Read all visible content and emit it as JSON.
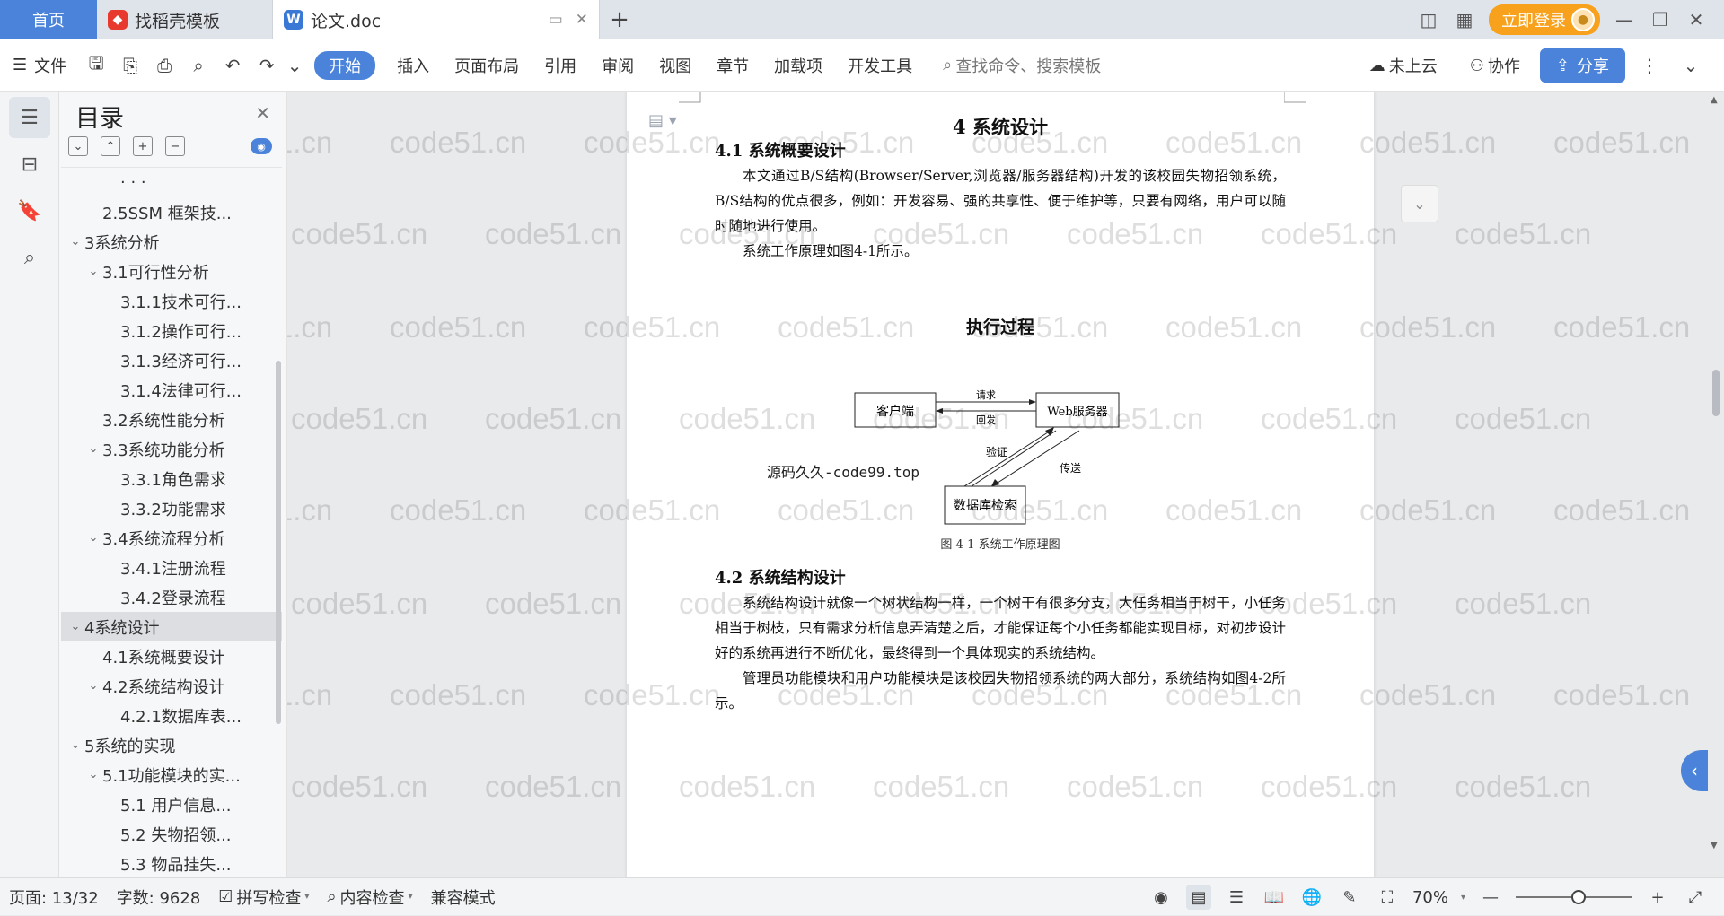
{
  "tabs": {
    "home": "首页",
    "template": "找稻壳模板",
    "doc": "论文.doc"
  },
  "topbar": {
    "login": "立即登录"
  },
  "toolbar": {
    "file": "文件",
    "start": "开始",
    "insert": "插入",
    "layout": "页面布局",
    "reference": "引用",
    "review": "审阅",
    "view": "视图",
    "chapter": "章节",
    "addons": "加载项",
    "devtools": "开发工具",
    "search_placeholder": "查找命令、搜索模板",
    "cloud": "未上云",
    "collab": "协作",
    "share": "分享"
  },
  "nav": {
    "title": "目录",
    "items": [
      {
        "label": "· · ·",
        "level": 3,
        "chev": ""
      },
      {
        "label": "2.5SSM 框架技...",
        "level": 2,
        "chev": ""
      },
      {
        "label": "3系统分析",
        "level": 1,
        "chev": "v"
      },
      {
        "label": "3.1可行性分析",
        "level": 2,
        "chev": "v"
      },
      {
        "label": "3.1.1技术可行...",
        "level": 3,
        "chev": ""
      },
      {
        "label": "3.1.2操作可行...",
        "level": 3,
        "chev": ""
      },
      {
        "label": "3.1.3经济可行...",
        "level": 3,
        "chev": ""
      },
      {
        "label": "3.1.4法律可行...",
        "level": 3,
        "chev": ""
      },
      {
        "label": "3.2系统性能分析",
        "level": 2,
        "chev": ""
      },
      {
        "label": "3.3系统功能分析",
        "level": 2,
        "chev": "v"
      },
      {
        "label": "3.3.1角色需求",
        "level": 3,
        "chev": ""
      },
      {
        "label": "3.3.2功能需求",
        "level": 3,
        "chev": ""
      },
      {
        "label": "3.4系统流程分析",
        "level": 2,
        "chev": "v"
      },
      {
        "label": "3.4.1注册流程",
        "level": 3,
        "chev": ""
      },
      {
        "label": "3.4.2登录流程",
        "level": 3,
        "chev": ""
      },
      {
        "label": "4系统设计",
        "level": 1,
        "chev": "v",
        "selected": true
      },
      {
        "label": "4.1系统概要设计",
        "level": 2,
        "chev": ""
      },
      {
        "label": "4.2系统结构设计",
        "level": 2,
        "chev": "v"
      },
      {
        "label": "4.2.1数据库表...",
        "level": 3,
        "chev": ""
      },
      {
        "label": "5系统的实现",
        "level": 1,
        "chev": "v"
      },
      {
        "label": "5.1功能模块的实...",
        "level": 2,
        "chev": "v"
      },
      {
        "label": "5.1 用户信息...",
        "level": 3,
        "chev": ""
      },
      {
        "label": "5.2  失物招领...",
        "level": 3,
        "chev": ""
      },
      {
        "label": "5.3 物品挂失...",
        "level": 3,
        "chev": ""
      }
    ]
  },
  "doc": {
    "chapter_title": "4 系统设计",
    "sec1_title": "4.1  系统概要设计",
    "sec1_p1": "本文通过B/S结构(Browser/Server,浏览器/服务器结构)开发的该校园失物招领系统，B/S结构的优点很多，例如：开发容易、强的共享性、便于维护等，只要有网络，用户可以随时随地进行使用。",
    "sec1_p2": "系统工作原理如图4-1所示。",
    "diagram_title": "执行过程",
    "diagram": {
      "client": "客户端",
      "server": "Web服务器",
      "db": "数据库检索",
      "request": "请求",
      "reply": "回发",
      "verify": "验证",
      "transfer": "传送",
      "stamp": "源码久久-code99.top"
    },
    "fig_caption": "图 4-1  系统工作原理图",
    "sec2_title": "4.2  系统结构设计",
    "sec2_p1": "系统结构设计就像一个树状结构一样，一个树干有很多分支，大任务相当于树干，小任务相当于树枝，只有需求分析信息弄清楚之后，才能保证每个小任务都能实现目标，对初步设计好的系统再进行不断优化，最终得到一个具体现实的系统结构。",
    "sec2_p2": "管理员功能模块和用户功能模块是该校园失物招领系统的两大部分，系统结构如图4-2所示。"
  },
  "watermark": "code51.cn",
  "status": {
    "page": "页面: 13/32",
    "words": "字数: 9628",
    "spell": "拼写检查",
    "content": "内容检查",
    "compat": "兼容模式",
    "zoom": "70%"
  },
  "colors": {
    "accent": "#4a83d9",
    "login": "#f7a11c"
  }
}
